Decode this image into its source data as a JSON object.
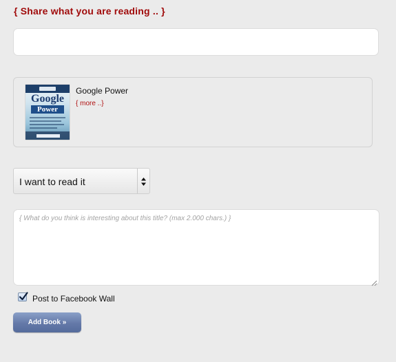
{
  "header": {
    "title": "{ Share what you are reading .. }"
  },
  "search": {
    "value": "",
    "placeholder": ""
  },
  "book": {
    "title": "Google Power",
    "more_link": "{ more ..}",
    "cover": {
      "title_line1": "Google",
      "title_line2": "Power"
    }
  },
  "reading_status": {
    "selected": "I want to read it"
  },
  "comment": {
    "placeholder": "{ What do you think is interesting about this title? (max 2.000 chars.) }",
    "value": ""
  },
  "facebook": {
    "label": "Post to Facebook Wall",
    "checked": true
  },
  "actions": {
    "add_book_label": "Add Book »"
  },
  "colors": {
    "background": "#ebebeb",
    "heading": "#a00b0b",
    "link": "#b01010",
    "button": "#6479a8"
  },
  "icons": {
    "select_arrows": "updown-arrows-icon",
    "checkbox_check": "checkmark-icon",
    "resize_grip": "resize-grip-icon"
  }
}
